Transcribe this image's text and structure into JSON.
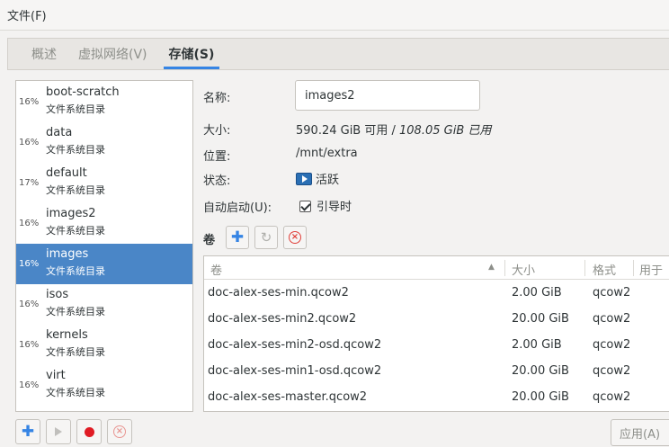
{
  "menubar": {
    "file": "文件(F)"
  },
  "tabs": [
    {
      "label": "概述",
      "active": false
    },
    {
      "label": "虚拟网络(V)",
      "active": false
    },
    {
      "label": "存储(S)",
      "active": true
    }
  ],
  "pools": [
    {
      "pct": "16%",
      "name": "boot-scratch",
      "type": "文件系统目录",
      "selected": false
    },
    {
      "pct": "16%",
      "name": "data",
      "type": "文件系统目录",
      "selected": false
    },
    {
      "pct": "17%",
      "name": "default",
      "type": "文件系统目录",
      "selected": false
    },
    {
      "pct": "16%",
      "name": "images2",
      "type": "文件系统目录",
      "selected": false
    },
    {
      "pct": "16%",
      "name": "images",
      "type": "文件系统目录",
      "selected": true
    },
    {
      "pct": "16%",
      "name": "isos",
      "type": "文件系统目录",
      "selected": false
    },
    {
      "pct": "16%",
      "name": "kernels",
      "type": "文件系统目录",
      "selected": false
    },
    {
      "pct": "16%",
      "name": "virt",
      "type": "文件系统目录",
      "selected": false
    }
  ],
  "details": {
    "name_label": "名称:",
    "name_value": "images2",
    "size_label": "大小:",
    "size_free": "590.24 GiB 可用 / ",
    "size_used": "108.05 GiB 已用",
    "location_label": "位置:",
    "location_value": "/mnt/extra",
    "state_label": "状态:",
    "state_value": "活跃",
    "autostart_label": "自动启动(U):",
    "autostart_value": "引导时",
    "autostart_checked": true
  },
  "volumes": {
    "label": "卷",
    "columns": [
      "卷",
      "大小",
      "格式",
      "用于"
    ],
    "sort_indicator": "▲",
    "rows": [
      {
        "name": "doc-alex-ses-min.qcow2",
        "size": "2.00 GiB",
        "format": "qcow2"
      },
      {
        "name": "doc-alex-ses-min2.qcow2",
        "size": "20.00 GiB",
        "format": "qcow2"
      },
      {
        "name": "doc-alex-ses-min2-osd.qcow2",
        "size": "2.00 GiB",
        "format": "qcow2"
      },
      {
        "name": "doc-alex-ses-min1-osd.qcow2",
        "size": "20.00 GiB",
        "format": "qcow2"
      },
      {
        "name": "doc-alex-ses-master.qcow2",
        "size": "20.00 GiB",
        "format": "qcow2"
      }
    ]
  },
  "icons": {
    "add": "plus-icon",
    "refresh": "refresh-icon",
    "delete": "delete-icon",
    "start": "play-icon",
    "stop": "record-icon",
    "state": "monitor-icon"
  },
  "apply_label": "应用(A)",
  "colors": {
    "accent": "#3584e4",
    "selection": "#4a86c7",
    "danger": "#e01b24"
  }
}
